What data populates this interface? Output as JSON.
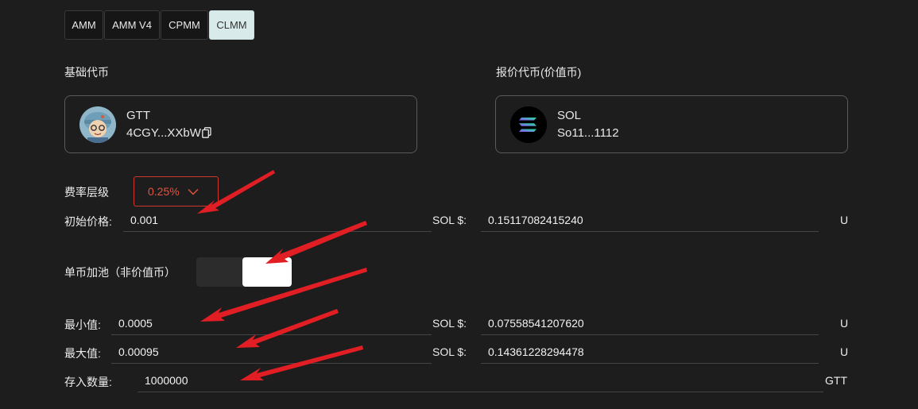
{
  "tabs": [
    {
      "label": "AMM",
      "active": false
    },
    {
      "label": "AMM V4",
      "active": false
    },
    {
      "label": "CPMM",
      "active": false
    },
    {
      "label": "CLMM",
      "active": true
    }
  ],
  "base_token": {
    "section_label": "基础代币",
    "symbol": "GTT",
    "address": "4CGY...XXbW",
    "icon": "cartoon-avatar-icon"
  },
  "quote_token": {
    "section_label": "报价代币(价值币)",
    "symbol": "SOL",
    "address": "So11...1112",
    "icon": "solana-logo-icon"
  },
  "fee_tier": {
    "label": "费率层级",
    "value": "0.25%"
  },
  "initial_price": {
    "label": "初始价格:",
    "value": "0.001",
    "quote_prefix": "SOL  $:",
    "usd_value": "0.15117082415240",
    "unit": "U"
  },
  "single_sided": {
    "label": "单币加池（非价值币）",
    "enabled": true
  },
  "min_price": {
    "label": "最小值:",
    "value": "0.0005",
    "quote_prefix": "SOL  $:",
    "usd_value": "0.07558541207620",
    "unit": "U"
  },
  "max_price": {
    "label": "最大值:",
    "value": "0.00095",
    "quote_prefix": "SOL  $:",
    "usd_value": "0.14361228294478",
    "unit": "U"
  },
  "deposit": {
    "label": "存入数量:",
    "value": "1000000",
    "unit": "GTT"
  },
  "colors": {
    "background": "#1d1d1d",
    "accent_red": "#e9513f",
    "arrow_red": "#e01e24",
    "active_tab": "#d9eaea"
  }
}
